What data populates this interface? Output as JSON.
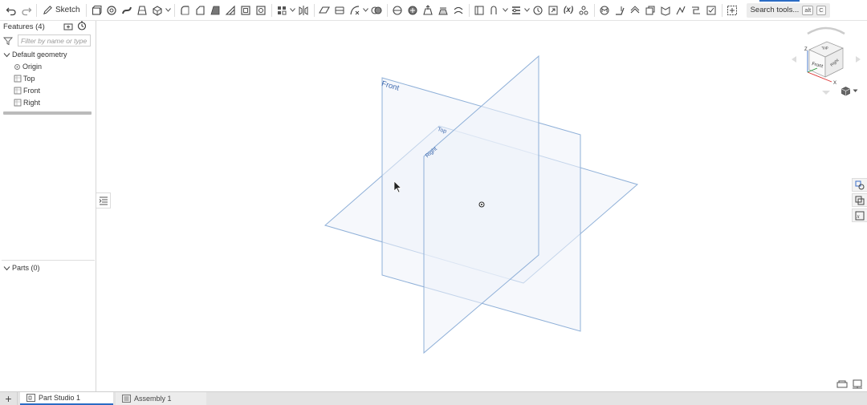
{
  "toolbar": {
    "sketch_label": "Sketch",
    "fx_label": "(x)",
    "search_label": "Search tools...",
    "search_key_alt": "alt",
    "search_key_c": "C"
  },
  "features": {
    "title": "Features (4)",
    "filter_placeholder": "Filter by name or type",
    "group_label": "Default geometry",
    "items": [
      {
        "label": "Origin",
        "icon": "origin-icon"
      },
      {
        "label": "Top",
        "icon": "plane-icon"
      },
      {
        "label": "Front",
        "icon": "plane-icon"
      },
      {
        "label": "Right",
        "icon": "plane-icon"
      }
    ],
    "parts_label": "Parts (0)"
  },
  "viewport": {
    "plane_labels": {
      "front": "Front",
      "top": "Top",
      "right": "Right"
    },
    "plane_color": "#8fb0d8",
    "plane_fill": "#eef3f9"
  },
  "view_cube": {
    "front": "Front",
    "top": "Top",
    "right": "Right",
    "axis_x": "X",
    "axis_z": "Z"
  },
  "tabs": [
    {
      "label": "Part Studio 1",
      "active": true
    },
    {
      "label": "Assembly 1",
      "active": false
    }
  ],
  "colors": {
    "accent": "#2b6cc4"
  }
}
